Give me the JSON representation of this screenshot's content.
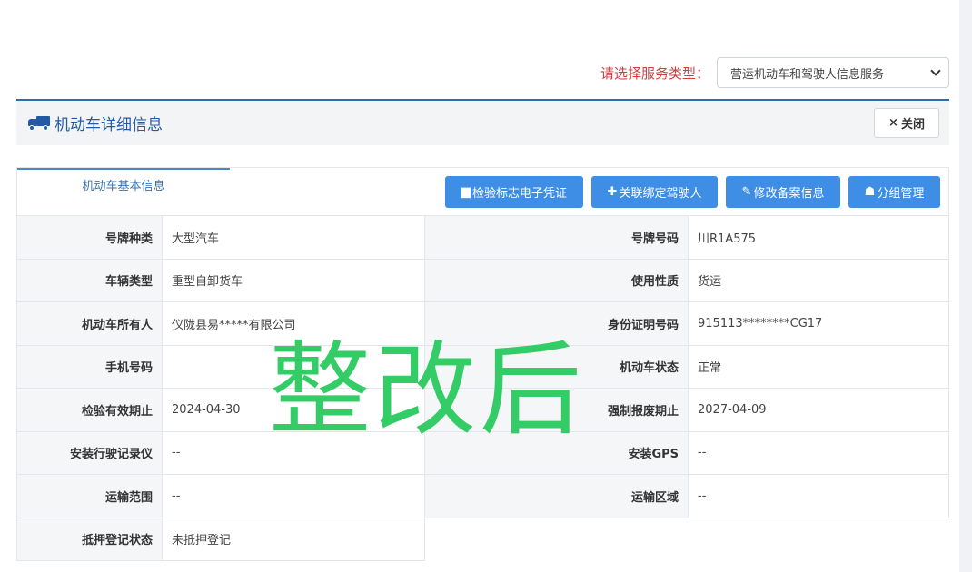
{
  "service": {
    "label": "请选择服务类型：",
    "selected": "营运机动车和驾驶人信息服务"
  },
  "header": {
    "title": "机动车详细信息",
    "close_label": "关闭",
    "close_icon": "×"
  },
  "tabs": [
    {
      "label": "机动车基本信息"
    }
  ],
  "actions": [
    {
      "icon": "▆",
      "label": "检验标志电子凭证"
    },
    {
      "icon": "✚",
      "label": "关联绑定驾驶人"
    },
    {
      "icon": "✎",
      "label": "修改备案信息"
    },
    {
      "icon": "☗",
      "label": "分组管理"
    }
  ],
  "rows": [
    {
      "l1": "号牌种类",
      "v1": "大型汽车",
      "l2": "号牌号码",
      "v2": "川R1A575"
    },
    {
      "l1": "车辆类型",
      "v1": "重型自卸货车",
      "l2": "使用性质",
      "v2": "货运"
    },
    {
      "l1": "机动车所有人",
      "v1": "仪陇县易*****有限公司",
      "l2": "身份证明号码",
      "v2": "915113********CG17"
    },
    {
      "l1": "手机号码",
      "v1": "",
      "l2": "机动车状态",
      "v2": "正常"
    },
    {
      "l1": "检验有效期止",
      "v1": "2024-04-30",
      "l2": "强制报废期止",
      "v2": "2027-04-09"
    },
    {
      "l1": "安装行驶记录仪",
      "v1": "--",
      "l2": "安装GPS",
      "v2": "--"
    },
    {
      "l1": "运输范围",
      "v1": "--",
      "l2": "运输区域",
      "v2": "--"
    },
    {
      "l1": "抵押登记状态",
      "v1": "未抵押登记"
    }
  ],
  "watermark": "整改后",
  "colors": {
    "primary": "#3f8ee6",
    "title_blue": "#235aa8",
    "label_red": "#c94040",
    "watermark_green": "#33cc66"
  }
}
